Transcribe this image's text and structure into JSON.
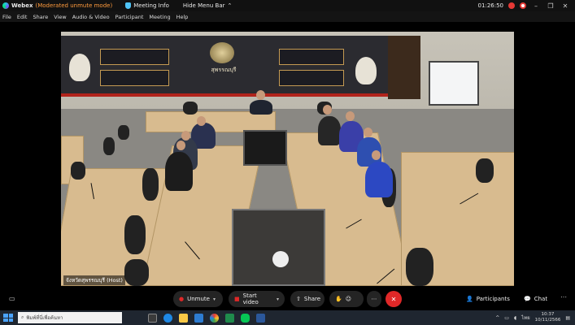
{
  "titlebar": {
    "app_name": "Webex",
    "mode": "(Moderated unmute mode)",
    "meeting_info": "Meeting Info",
    "hide_menu": "Hide Menu Bar",
    "timer": "01:26:50"
  },
  "menu": [
    "File",
    "Edit",
    "Share",
    "View",
    "Audio & Video",
    "Participant",
    "Meeting",
    "Help"
  ],
  "video": {
    "host_label": "จังหวัดสุพรรณบุรี (Host)",
    "banner_title": "สุพรรณบุรี"
  },
  "controls": {
    "unmute": "Unmute",
    "start_video": "Start video",
    "share": "Share",
    "participants": "Participants",
    "chat": "Chat"
  },
  "taskbar": {
    "search_placeholder": "พิมพ์ที่นี่เพื่อค้นหา",
    "lang": "ไทย",
    "time": "10:37",
    "date": "10/11/2566"
  },
  "colors": {
    "accent_red": "#e02828",
    "mode_orange": "#ff9b3d",
    "bar_bg": "#242424"
  },
  "icons": {
    "webex_logo": "webex-logo-icon",
    "meeting_info": "shield-icon",
    "recording": "record-icon",
    "search": "search-icon"
  }
}
